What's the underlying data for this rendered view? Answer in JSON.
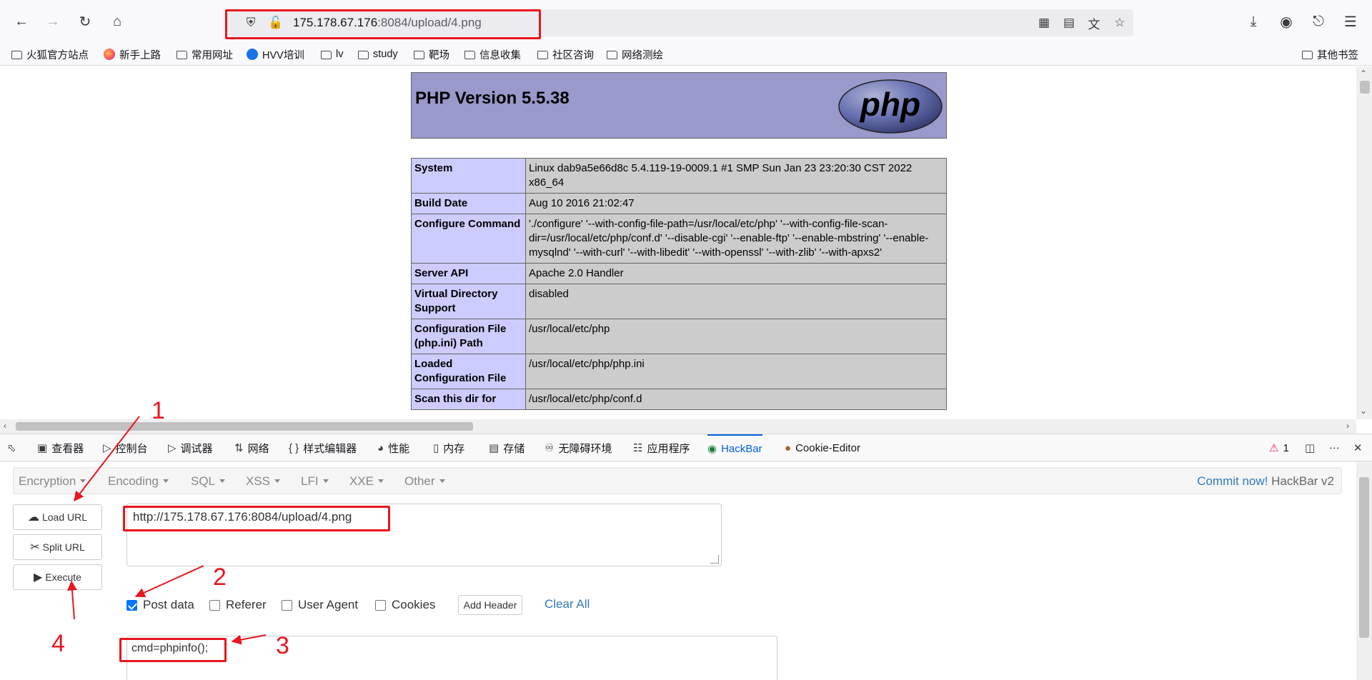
{
  "browser": {
    "url_host": "175.178.67.176",
    "url_rest": ":8084/upload/4.png"
  },
  "bookmarks": [
    {
      "label": "火狐官方站点",
      "icon": "folder-icon"
    },
    {
      "label": "新手上路",
      "icon": "firefox-icon"
    },
    {
      "label": "常用网址",
      "icon": "folder-icon"
    },
    {
      "label": "HVV培训",
      "icon": "site-icon"
    },
    {
      "label": "lv",
      "icon": "folder-icon"
    },
    {
      "label": "study",
      "icon": "folder-icon"
    },
    {
      "label": "靶场",
      "icon": "folder-icon"
    },
    {
      "label": "信息收集",
      "icon": "folder-icon"
    },
    {
      "label": "社区咨询",
      "icon": "folder-icon"
    },
    {
      "label": "网络测绘",
      "icon": "folder-icon"
    }
  ],
  "other_bookmarks": "其他书签",
  "phpinfo": {
    "title": "PHP Version 5.5.38",
    "logo_text": "php",
    "rows": [
      {
        "key": "System",
        "value": "Linux dab9a5e66d8c 5.4.119-19-0009.1 #1 SMP Sun Jan 23 23:20:30 CST 2022 x86_64"
      },
      {
        "key": "Build Date",
        "value": "Aug 10 2016 21:02:47"
      },
      {
        "key": "Configure Command",
        "value": "'./configure' '--with-config-file-path=/usr/local/etc/php' '--with-config-file-scan-dir=/usr/local/etc/php/conf.d' '--disable-cgi' '--enable-ftp' '--enable-mbstring' '--enable-mysqlnd' '--with-curl' '--with-libedit' '--with-openssl' '--with-zlib' '--with-apxs2'"
      },
      {
        "key": "Server API",
        "value": "Apache 2.0 Handler"
      },
      {
        "key": "Virtual Directory Support",
        "value": "disabled"
      },
      {
        "key": "Configuration File (php.ini) Path",
        "value": "/usr/local/etc/php"
      },
      {
        "key": "Loaded Configuration File",
        "value": "/usr/local/etc/php/php.ini"
      },
      {
        "key": "Scan this dir for",
        "value": "/usr/local/etc/php/conf.d"
      }
    ]
  },
  "devtools": {
    "tabs": [
      {
        "label": "查看器",
        "icon": "inspector-icon"
      },
      {
        "label": "控制台",
        "icon": "console-icon"
      },
      {
        "label": "调试器",
        "icon": "debugger-icon"
      },
      {
        "label": "网络",
        "icon": "network-icon"
      },
      {
        "label": "样式编辑器",
        "icon": "style-editor-icon"
      },
      {
        "label": "性能",
        "icon": "performance-icon"
      },
      {
        "label": "内存",
        "icon": "memory-icon"
      },
      {
        "label": "存储",
        "icon": "storage-icon"
      },
      {
        "label": "无障碍环境",
        "icon": "accessibility-icon"
      },
      {
        "label": "应用程序",
        "icon": "application-icon"
      },
      {
        "label": "HackBar",
        "icon": "hackbar-icon"
      },
      {
        "label": "Cookie-Editor",
        "icon": "cookie-icon"
      }
    ],
    "error_count": "1"
  },
  "hackbar": {
    "menus": [
      "Encryption",
      "Encoding",
      "SQL",
      "XSS",
      "LFI",
      "XXE",
      "Other"
    ],
    "commit_link": "Commit now!",
    "brand": "HackBar v2",
    "buttons": {
      "load_url": "Load URL",
      "split_url": "Split URL",
      "execute": "Execute"
    },
    "url_value": "http://175.178.67.176:8084/upload/4.png",
    "options": [
      {
        "label": "Post data",
        "checked": true
      },
      {
        "label": "Referer",
        "checked": false
      },
      {
        "label": "User Agent",
        "checked": false
      },
      {
        "label": "Cookies",
        "checked": false
      }
    ],
    "add_header": "Add Header",
    "clear_all": "Clear All",
    "post_value": "cmd=phpinfo();"
  },
  "annotations": [
    "1",
    "2",
    "3",
    "4"
  ],
  "colors": {
    "annotation": "#e8161f",
    "hackbar_link": "#337ab7",
    "php_header": "#9999cc",
    "php_key": "#ccccff",
    "php_value": "#cccccc"
  }
}
